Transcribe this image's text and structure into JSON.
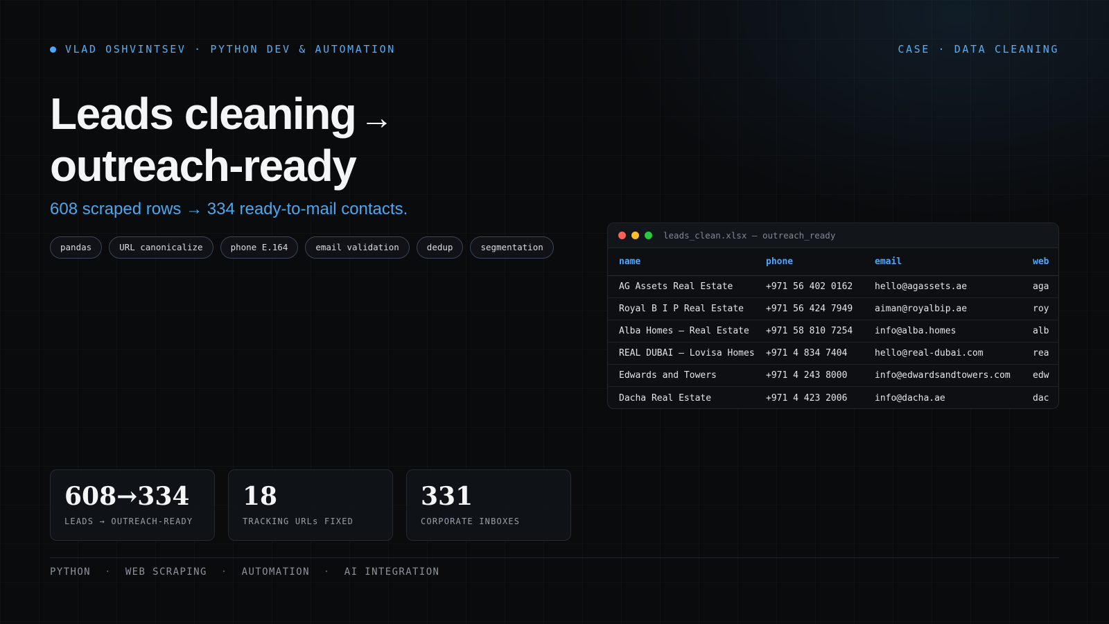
{
  "header": {
    "brand": "VLAD OSHVINTSEV · PYTHON DEV & AUTOMATION",
    "case": "CASE · DATA CLEANING"
  },
  "hero": {
    "title_line1": "Leads cleaning",
    "title_arrow": "→",
    "title_line2": "outreach-ready",
    "subtitle": "608 scraped rows → 334 ready-to-mail contacts."
  },
  "tags": [
    "pandas",
    "URL canonicalize",
    "phone E.164",
    "email validation",
    "dedup",
    "segmentation"
  ],
  "window": {
    "title": "leads_clean.xlsx — outreach_ready",
    "columns": [
      "name",
      "phone",
      "email",
      "web"
    ],
    "rows": [
      [
        "AG Assets Real Estate",
        "+971 56 402 0162",
        "hello@agassets.ae",
        "aga"
      ],
      [
        "Royal B I P Real Estate",
        "+971 56 424 7949",
        "aiman@royalbip.ae",
        "roy"
      ],
      [
        "Alba Homes — Real Estate",
        "+971 58 810 7254",
        "info@alba.homes",
        "alb"
      ],
      [
        "REAL DUBAI — Lovisa Homes",
        "+971 4 834 7404",
        "hello@real-dubai.com",
        "rea"
      ],
      [
        "Edwards and Towers",
        "+971 4 243 8000",
        "info@edwardsandtowers.com",
        "edw"
      ],
      [
        "Dacha Real Estate",
        "+971 4 423 2006",
        "info@dacha.ae",
        "dac"
      ]
    ]
  },
  "stats": [
    {
      "value": "608→334",
      "label": "LEADS → OUTREACH-READY"
    },
    {
      "value": "18",
      "label": "TRACKING URLs FIXED"
    },
    {
      "value": "331",
      "label": "CORPORATE INBOXES"
    }
  ],
  "footer": {
    "items": [
      "PYTHON",
      "WEB SCRAPING",
      "AUTOMATION",
      "AI INTEGRATION"
    ],
    "separator": "·"
  },
  "colors": {
    "accent": "#4aa8ff",
    "background": "#0a0b0d",
    "light_red": "#ff5f57",
    "light_yellow": "#febc2e",
    "light_green": "#28c840"
  }
}
